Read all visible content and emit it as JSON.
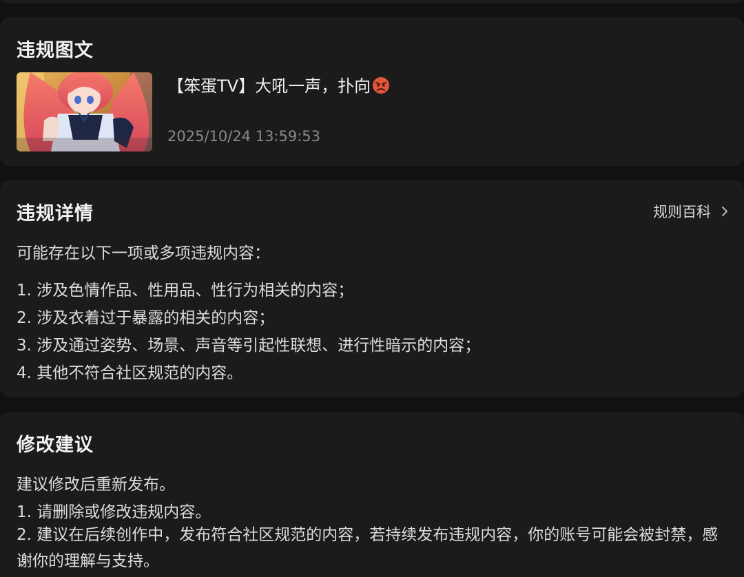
{
  "violation_card": {
    "title": "违规图文",
    "post_title": "【笨蛋TV】大吼一声，扑向",
    "post_time": "2025/10/24 13:59:53",
    "emoji_icon": "angry-face-icon",
    "thumbnail_description": "anime-illustration"
  },
  "details_card": {
    "title": "违规详情",
    "rules_link_label": "规则百科",
    "intro": "可能存在以下一项或多项违规内容：",
    "items": [
      "1. 涉及色情作品、性用品、性行为相关的内容；",
      "2. 涉及衣着过于暴露的相关的内容；",
      "3. 涉及通过姿势、场景、声音等引起性联想、进行性暗示的内容；",
      "4. 其他不符合社区规范的内容。"
    ]
  },
  "suggest_card": {
    "title": "修改建议",
    "intro": "建议修改后重新发布。",
    "items": [
      "1. 请删除或修改违规内容。",
      "2. 建议在后续创作中，发布符合社区规范的内容，若持续发布违规内容，你的账号可能会被封禁，感谢你的理解与支持。"
    ]
  },
  "colors": {
    "background": "#111111",
    "card": "#1b1b1b",
    "text_primary": "#f2f2f2",
    "text_secondary": "#8a8a8a"
  }
}
